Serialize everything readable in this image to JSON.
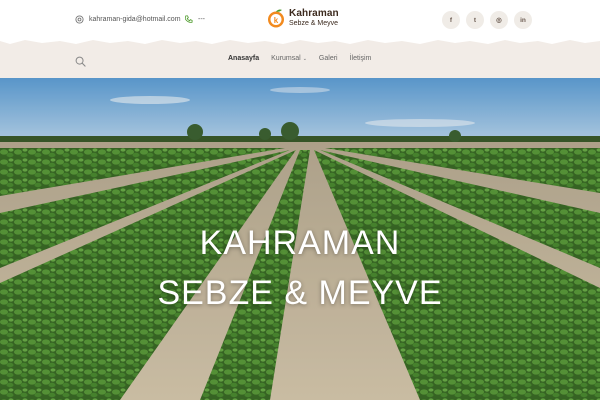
{
  "topbar": {
    "email": "kahraman-gida@hotmail.com",
    "phone": "---"
  },
  "logo": {
    "name": "Kahraman",
    "subtitle": "Sebze & Meyve",
    "mark_letter": "k"
  },
  "socials": [
    {
      "icon": "facebook-icon",
      "glyph": "f"
    },
    {
      "icon": "twitter-icon",
      "glyph": "t"
    },
    {
      "icon": "instagram-icon",
      "glyph": "◎"
    },
    {
      "icon": "linkedin-icon",
      "glyph": "in"
    }
  ],
  "nav": {
    "items": [
      {
        "label": "Anasayfa"
      },
      {
        "label": "Kurumsal"
      },
      {
        "label": "Galeri"
      },
      {
        "label": "İletişim"
      }
    ]
  },
  "hero": {
    "title_line1": "KAHRAMAN",
    "title_line2": "SEBZE & MEYVE"
  },
  "colors": {
    "brand_orange": "#f28a1e",
    "brand_green": "#4c9a2a",
    "nav_bg": "#f2ece7",
    "text_dark": "#3c2a1e"
  }
}
